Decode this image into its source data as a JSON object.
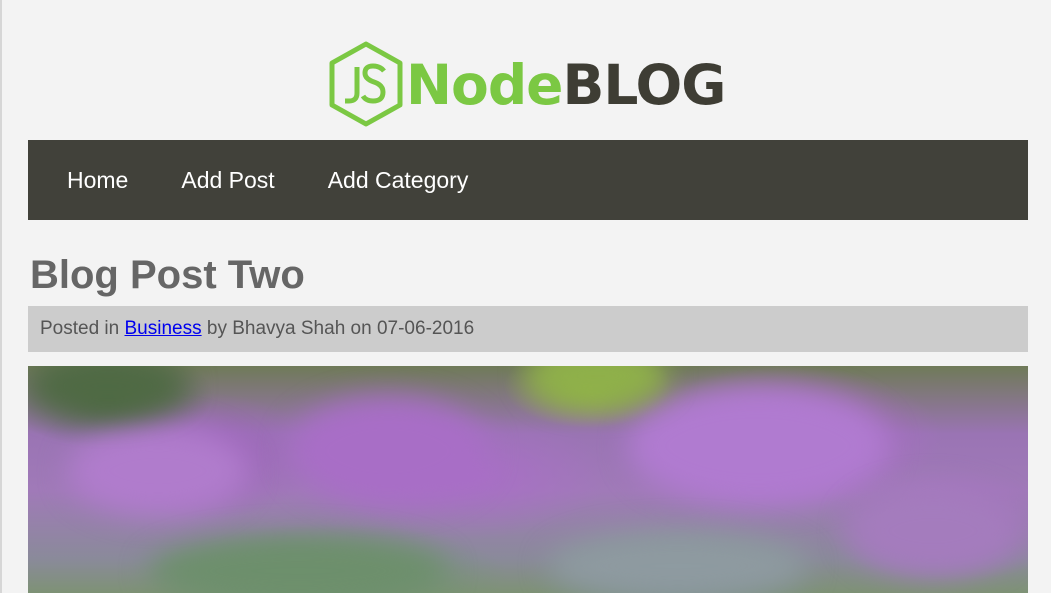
{
  "logo": {
    "text_node": "Node",
    "text_blog": "BLOG",
    "badge": "JS"
  },
  "nav": {
    "items": [
      {
        "label": "Home"
      },
      {
        "label": "Add Post"
      },
      {
        "label": "Add Category"
      }
    ]
  },
  "post": {
    "title": "Blog Post Two",
    "meta": {
      "posted_in_label": "Posted in ",
      "category": "Business",
      "by_label": " by ",
      "author": "Bhavya Shah",
      "on_label": " on ",
      "date": "07-06-2016"
    }
  },
  "colors": {
    "accent_green": "#7bc843",
    "nav_background": "#41413a",
    "meta_background": "#cccccc",
    "link": "#0000ee"
  }
}
